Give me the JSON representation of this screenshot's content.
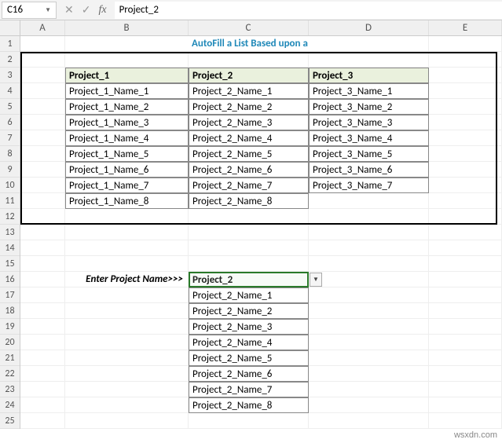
{
  "namebox": "C16",
  "formula_bar": "Project_2",
  "fx_label": "fx",
  "columns": [
    "A",
    "B",
    "C",
    "D",
    "E"
  ],
  "rows": [
    "1",
    "2",
    "3",
    "4",
    "5",
    "6",
    "7",
    "8",
    "9",
    "10",
    "11",
    "12",
    "13",
    "14",
    "15",
    "16",
    "17",
    "18",
    "19",
    "20",
    "21",
    "22",
    "23",
    "24",
    "25"
  ],
  "title": "AutoFill a List Based upon a Cell Value",
  "table": {
    "headers": [
      "Project_1",
      "Project_2",
      "Project_3"
    ],
    "rows": [
      [
        "Project_1_Name_1",
        "Project_2_Name_1",
        "Project_3_Name_1"
      ],
      [
        "Project_1_Name_2",
        "Project_2_Name_2",
        "Project_3_Name_2"
      ],
      [
        "Project_1_Name_3",
        "Project_2_Name_3",
        "Project_3_Name_3"
      ],
      [
        "Project_1_Name_4",
        "Project_2_Name_4",
        "Project_3_Name_4"
      ],
      [
        "Project_1_Name_5",
        "Project_2_Name_5",
        "Project_3_Name_5"
      ],
      [
        "Project_1_Name_6",
        "Project_2_Name_6",
        "Project_3_Name_6"
      ],
      [
        "Project_1_Name_7",
        "Project_2_Name_7",
        "Project_3_Name_7"
      ],
      [
        "Project_1_Name_8",
        "Project_2_Name_8",
        ""
      ]
    ]
  },
  "prompt_label": "Enter Project Name>>>",
  "dropdown": {
    "selected": "Project_2",
    "results": [
      "Project_2_Name_1",
      "Project_2_Name_2",
      "Project_2_Name_3",
      "Project_2_Name_4",
      "Project_2_Name_5",
      "Project_2_Name_6",
      "Project_2_Name_7",
      "Project_2_Name_8"
    ]
  },
  "watermark": "wsxdn.com"
}
